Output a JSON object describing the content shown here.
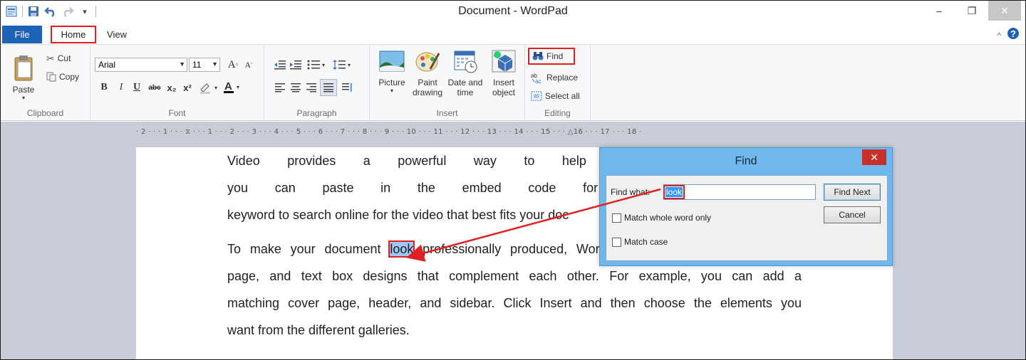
{
  "window": {
    "title": "Document - WordPad"
  },
  "tabs": {
    "file": "File",
    "home": "Home",
    "view": "View"
  },
  "ribbon": {
    "clipboard": {
      "paste": "Paste",
      "cut": "Cut",
      "copy": "Copy",
      "label": "Clipboard"
    },
    "font": {
      "family": "Arial",
      "size": "11",
      "bold": "B",
      "italic": "I",
      "underline": "U",
      "strike": "abc",
      "sub": "x₂",
      "sup": "x²",
      "label": "Font"
    },
    "paragraph": {
      "label": "Paragraph"
    },
    "insert": {
      "picture": "Picture",
      "paint_1": "Paint",
      "paint_2": "drawing",
      "datetime_1": "Date and",
      "datetime_2": "time",
      "object_1": "Insert",
      "object_2": "object",
      "label": "Insert"
    },
    "editing": {
      "find": "Find",
      "replace": "Replace",
      "select_all": "Select all",
      "label": "Editing"
    }
  },
  "ruler": {
    "text": "· 2 · · · 1 · · · ⧖ · · · 1 · · · 2 · · · 3 · · · 4 · · · 5 · · · 6 · · · 7 · · · 8 · · · 9 · · · 10 · · · 11 · · · 12 · · · 13 · · · 14 · · · 15 · · · △16 · · · 17 · · · 18 ·"
  },
  "document": {
    "para1": [
      "Video provides a powerful way to help you prove your point",
      "you can paste in the embed code for the video you want",
      "keyword to search online for the video that best fits your doc"
    ],
    "para2_line1_before": "To make your document ",
    "para2_highlight": "look",
    "para2_line1_after": " professionally produced, Word provides header, footer, cover",
    "para2_rest": [
      "page, and text box designs that complement each other. For example, you can add a",
      "matching cover page, header, and sidebar. Click Insert and then choose the elements you",
      "want from the different galleries."
    ]
  },
  "find_dialog": {
    "title": "Find",
    "find_what_label": "Find what:",
    "find_what_value": "look",
    "find_next": "Find Next",
    "cancel": "Cancel",
    "match_whole_word": "Match whole word only",
    "match_case": "Match case"
  },
  "colors": {
    "file_tab": "#1e63b8",
    "annotation": "#e02020",
    "selection": "#3399ff",
    "dialog_frame": "#6fb8ee"
  }
}
